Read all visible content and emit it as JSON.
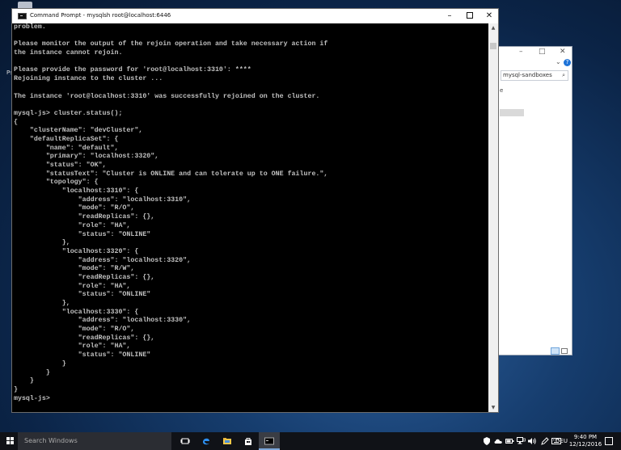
{
  "desktop": {
    "fragment_text": "P₅"
  },
  "explorer": {
    "address": "mysql-sandboxes",
    "fragment": "e",
    "minimize_glyph": "–",
    "maximize_glyph": "□",
    "close_glyph": "✕",
    "chevron_glyph": "⌄",
    "help_glyph": "?",
    "search_glyph": "⌕"
  },
  "cmd": {
    "title": "Command Prompt - mysqlsh  root@localhost:6446",
    "minimize_glyph": "–",
    "close_glyph": "✕",
    "lines": [
      "problem.",
      "",
      "Please monitor the output of the rejoin operation and take necessary action if",
      "the instance cannot rejoin.",
      "",
      "Please provide the password for 'root@localhost:3310': ****",
      "Rejoining instance to the cluster ...",
      "",
      "The instance 'root@localhost:3310' was successfully rejoined on the cluster.",
      "",
      "mysql-js> cluster.status();",
      "{",
      "    \"clusterName\": \"devCluster\",",
      "    \"defaultReplicaSet\": {",
      "        \"name\": \"default\",",
      "        \"primary\": \"localhost:3320\",",
      "        \"status\": \"OK\",",
      "        \"statusText\": \"Cluster is ONLINE and can tolerate up to ONE failure.\",",
      "        \"topology\": {",
      "            \"localhost:3310\": {",
      "                \"address\": \"localhost:3310\",",
      "                \"mode\": \"R/O\",",
      "                \"readReplicas\": {},",
      "                \"role\": \"HA\",",
      "                \"status\": \"ONLINE\"",
      "            },",
      "            \"localhost:3320\": {",
      "                \"address\": \"localhost:3320\",",
      "                \"mode\": \"R/W\",",
      "                \"readReplicas\": {},",
      "                \"role\": \"HA\",",
      "                \"status\": \"ONLINE\"",
      "            },",
      "            \"localhost:3330\": {",
      "                \"address\": \"localhost:3330\",",
      "                \"mode\": \"R/O\",",
      "                \"readReplicas\": {},",
      "                \"role\": \"HA\",",
      "                \"status\": \"ONLINE\"",
      "            }",
      "        }",
      "    }",
      "}",
      "mysql-js> "
    ],
    "scroll_up_glyph": "▲",
    "scroll_down_glyph": "▼"
  },
  "taskbar": {
    "search_placeholder": "Search Windows",
    "language": "DEU",
    "time": "9:40 PM",
    "date": "12/12/2016",
    "icons": [
      "windows-start-icon",
      "task-view-icon",
      "edge-icon",
      "file-explorer-icon",
      "store-icon",
      "command-prompt-icon"
    ],
    "tray_icons": [
      "shield-icon",
      "cloud-icon",
      "battery-icon",
      "network-icon",
      "volume-icon",
      "pen-icon",
      "keyboard-icon"
    ]
  }
}
